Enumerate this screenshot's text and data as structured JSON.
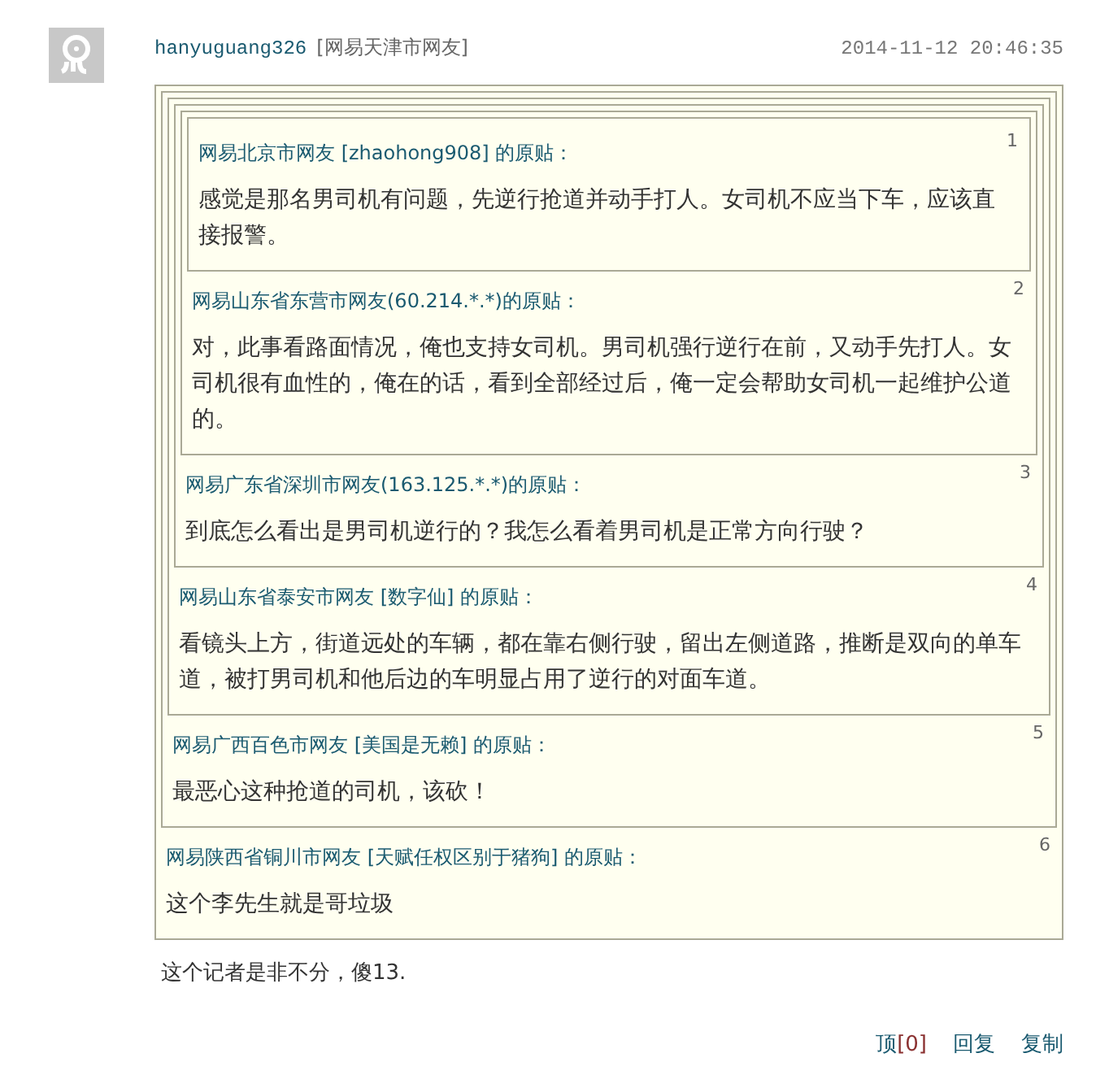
{
  "post": {
    "username": "hanyuguang326",
    "location": "[网易天津市网友]",
    "time": "2014-11-12 20:46:35",
    "quote": {
      "floor": "6",
      "source": "网易陕西省铜川市网友 [天赋任权区别于猪狗] 的原贴：",
      "text": "这个李先生就是哥垃圾",
      "quote": {
        "floor": "5",
        "source": "网易广西百色市网友 [美国是无赖] 的原贴：",
        "text": "最恶心这种抢道的司机，该砍！",
        "quote": {
          "floor": "4",
          "source": "网易山东省泰安市网友 [数字仙] 的原贴：",
          "text": "看镜头上方，街道远处的车辆，都在靠右侧行驶，留出左侧道路，推断是双向的单车道，被打男司机和他后边的车明显占用了逆行的对面车道。",
          "quote": {
            "floor": "3",
            "source": "网易广东省深圳市网友(163.125.*.*)的原贴：",
            "text": "到底怎么看出是男司机逆行的？我怎么看着男司机是正常方向行驶？",
            "quote": {
              "floor": "2",
              "source": "网易山东省东营市网友(60.214.*.*)的原贴：",
              "text": "对，此事看路面情况，俺也支持女司机。男司机强行逆行在前，又动手先打人。女司机很有血性的，俺在的话，看到全部经过后，俺一定会帮助女司机一起维护公道的。",
              "quote": {
                "floor": "1",
                "source": "网易北京市网友 [zhaohong908] 的原贴：",
                "text": "感觉是那名男司机有问题，先逆行抢道并动手打人。女司机不应当下车，应该直接报警。"
              }
            }
          }
        }
      }
    },
    "text": "这个记者是非不分，傻13.",
    "actions": [
      {
        "kind": "vote",
        "label": "顶",
        "count": "[0]"
      },
      {
        "kind": "link",
        "label": "回复"
      },
      {
        "kind": "link",
        "label": "复制"
      }
    ]
  }
}
